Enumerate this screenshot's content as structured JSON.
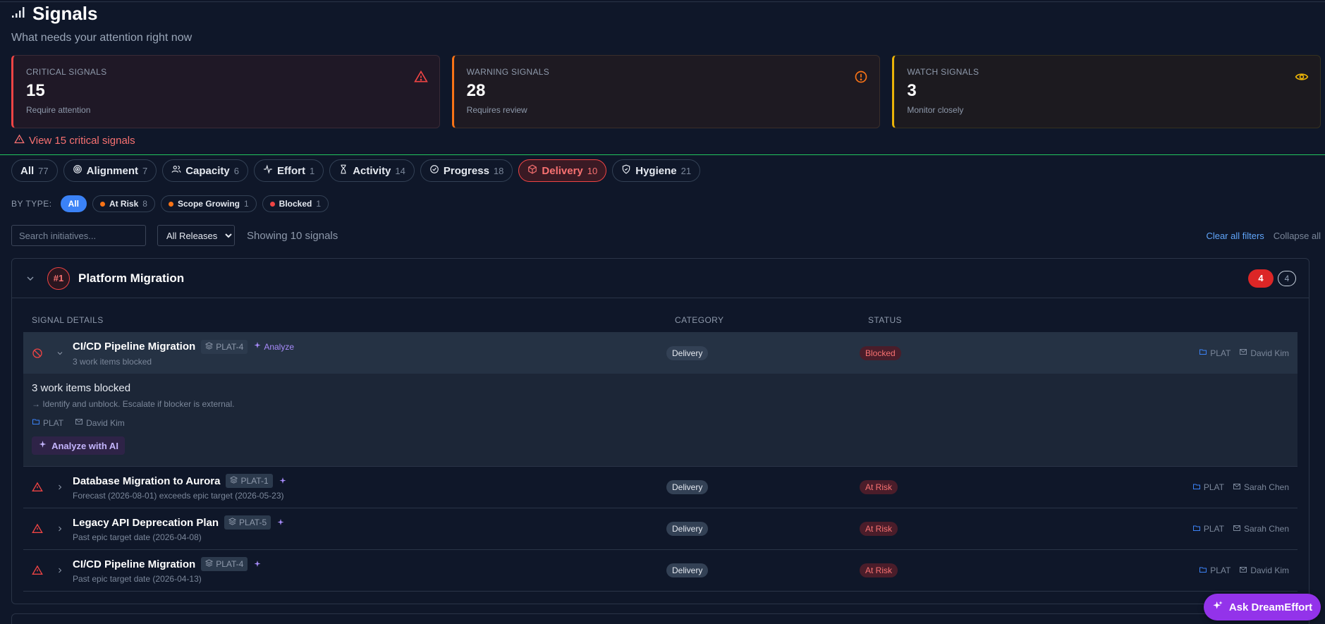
{
  "header": {
    "title": "Signals",
    "subtitle": "What needs your attention right now"
  },
  "cards": [
    {
      "label": "CRITICAL SIGNALS",
      "value": "15",
      "sub": "Require attention",
      "color": "#ef4444",
      "icon": "alert-triangle-icon"
    },
    {
      "label": "WARNING SIGNALS",
      "value": "28",
      "sub": "Requires review",
      "color": "#f97316",
      "icon": "alert-circle-icon"
    },
    {
      "label": "WATCH SIGNALS",
      "value": "3",
      "sub": "Monitor closely",
      "color": "#eab308",
      "icon": "eye-icon"
    }
  ],
  "critical_link": "View 15 critical signals",
  "tabs": [
    {
      "label": "All",
      "count": "77"
    },
    {
      "label": "Alignment",
      "count": "7"
    },
    {
      "label": "Capacity",
      "count": "6"
    },
    {
      "label": "Effort",
      "count": "1"
    },
    {
      "label": "Activity",
      "count": "14"
    },
    {
      "label": "Progress",
      "count": "18"
    },
    {
      "label": "Delivery",
      "count": "10"
    },
    {
      "label": "Hygiene",
      "count": "21"
    }
  ],
  "by_type": {
    "label": "BY TYPE:",
    "chips": [
      {
        "label": "All",
        "count": ""
      },
      {
        "label": "At Risk",
        "count": "8",
        "dot": "#f97316"
      },
      {
        "label": "Scope Growing",
        "count": "1",
        "dot": "#f97316"
      },
      {
        "label": "Blocked",
        "count": "1",
        "dot": "#ef4444"
      }
    ]
  },
  "filters": {
    "search_placeholder": "Search initiatives...",
    "release_selected": "All Releases",
    "showing": "Showing 10 signals",
    "clear": "Clear all filters",
    "collapse": "Collapse all"
  },
  "group": {
    "rank": "#1",
    "name": "Platform Migration",
    "badge_red": "4",
    "badge_outline": "4",
    "columns": [
      "SIGNAL DETAILS",
      "CATEGORY",
      "STATUS"
    ]
  },
  "rows": [
    {
      "title": "CI/CD Pipeline Migration",
      "key": "PLAT-4",
      "analyze": "Analyze",
      "sub": "3 work items blocked",
      "category": "Delivery",
      "status": "Blocked",
      "project": "PLAT",
      "owner": "David Kim"
    },
    {
      "title": "Database Migration to Aurora",
      "key": "PLAT-1",
      "sub": "Forecast (2026-08-01) exceeds epic target (2026-05-23)",
      "category": "Delivery",
      "status": "At Risk",
      "project": "PLAT",
      "owner": "Sarah Chen"
    },
    {
      "title": "Legacy API Deprecation Plan",
      "key": "PLAT-5",
      "sub": "Past epic target date (2026-04-08)",
      "category": "Delivery",
      "status": "At Risk",
      "project": "PLAT",
      "owner": "Sarah Chen"
    },
    {
      "title": "CI/CD Pipeline Migration",
      "key": "PLAT-4",
      "sub": "Past epic target date (2026-04-13)",
      "category": "Delivery",
      "status": "At Risk",
      "project": "PLAT",
      "owner": "David Kim"
    }
  ],
  "expanded": {
    "title": "3 work items blocked",
    "action": "→ Identify and unblock. Escalate if blocker is external.",
    "project": "PLAT",
    "owner": "David Kim",
    "analyze_ai": "Analyze with AI"
  },
  "ask_button": "Ask DreamEffort"
}
